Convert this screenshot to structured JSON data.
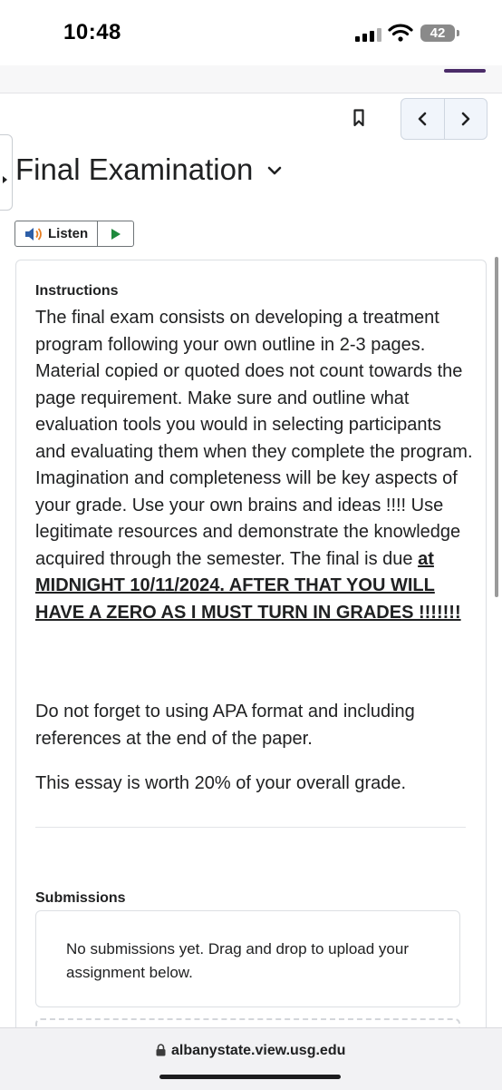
{
  "status_bar": {
    "time": "10:48",
    "battery": "42"
  },
  "nav": {
    "prev_label": "Previous",
    "next_label": "Next"
  },
  "page": {
    "title": "Final Examination"
  },
  "listen": {
    "label": "Listen"
  },
  "instructions": {
    "heading": "Instructions",
    "body_plain": "The final exam consists on developing a treatment program following your own outline in 2-3 pages. Material copied or quoted does not count towards the page requirement. Make sure and outline what evaluation tools you would in selecting participants and evaluating them when they complete the program. Imagination and completeness will be key aspects of your grade. Use your own brains and ideas !!!! Use legitimate resources and demonstrate the knowledge acquired through the semester. The final is due ",
    "body_emphasis": "at MIDNIGHT 10/11/2024. AFTER THAT YOU WILL HAVE A ZERO AS I MUST TURN IN GRADES !!!!!!!",
    "para2": "Do not forget to using APA format and including references at the end of the paper.",
    "para3": "This essay is worth 20% of your overall grade."
  },
  "submissions": {
    "heading": "Submissions",
    "empty_text": "No submissions yet. Drag and drop to upload your assignment below."
  },
  "browser": {
    "url": "albanystate.view.usg.edu"
  }
}
